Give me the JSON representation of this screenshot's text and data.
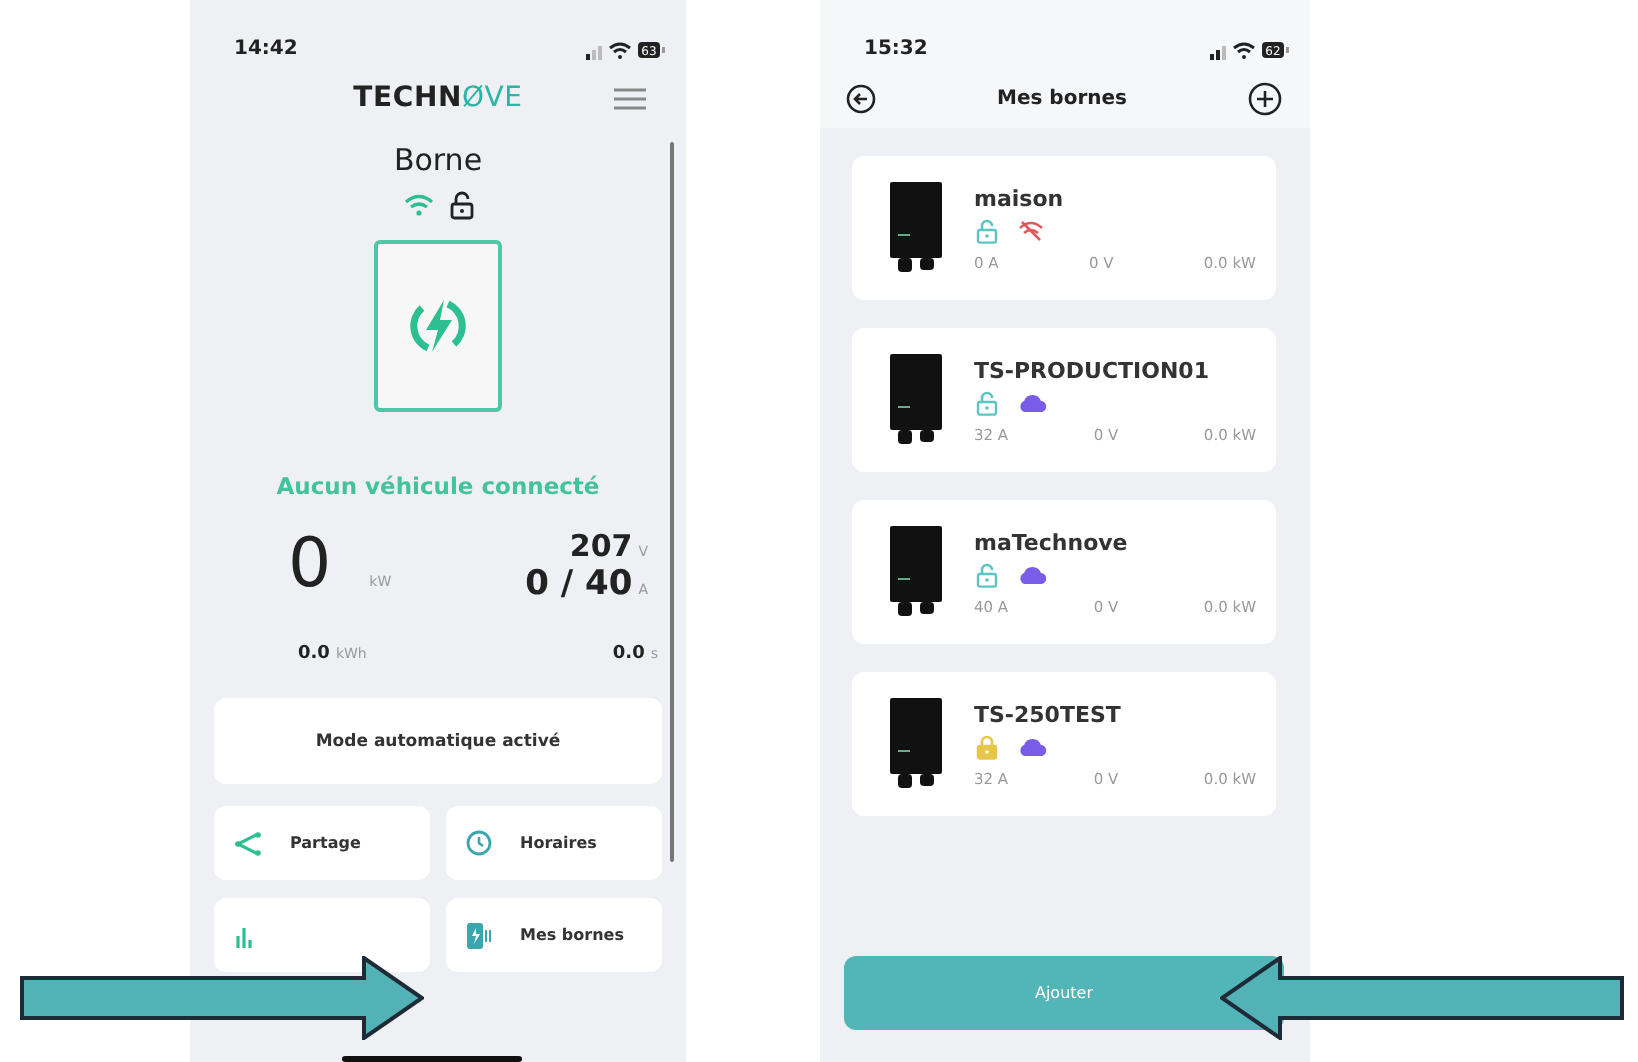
{
  "screens": [
    {
      "kind": "dashboard",
      "status": {
        "time": "14:42",
        "battery": "63"
      },
      "logo": {
        "dark": "TECHN",
        "accent": "ØVE"
      },
      "title": "Borne",
      "wifi": true,
      "locked": false,
      "message": "Aucun véhicule connecté",
      "power": {
        "value": "0",
        "unit": "kW"
      },
      "voltage": {
        "value": "207",
        "unit": "V"
      },
      "current": {
        "value": "0 / 40",
        "unit": "A"
      },
      "energy": {
        "value": "0.0",
        "unit": "kWh"
      },
      "duration": {
        "value": "0.0",
        "unit": "s"
      },
      "mode": "Mode automatique activé",
      "menu": [
        {
          "kind": "share",
          "label": "Partage"
        },
        {
          "kind": "clock",
          "label": "Horaires"
        },
        {
          "kind": "stats"
        },
        {
          "kind": "charger",
          "label": "Mes bornes"
        }
      ]
    },
    {
      "kind": "list",
      "status": {
        "time": "15:32",
        "battery": "62"
      },
      "title": "Mes bornes",
      "chargers": [
        {
          "name": "maison",
          "locked": false,
          "kind": "offline",
          "current": "0 A",
          "voltage": "0 V",
          "power": "0.0 kW"
        },
        {
          "name": "TS-PRODUCTION01",
          "locked": false,
          "kind": "cloud",
          "current": "32 A",
          "voltage": "0 V",
          "power": "0.0 kW"
        },
        {
          "name": "maTechnove",
          "locked": false,
          "kind": "cloud",
          "current": "40 A",
          "voltage": "0 V",
          "power": "0.0 kW"
        },
        {
          "name": "TS-250TEST",
          "locked": true,
          "kind": "cloud",
          "current": "32 A",
          "voltage": "0 V",
          "power": "0.0 kW"
        }
      ],
      "add_button": "Ajouter"
    }
  ],
  "arrows": [
    {
      "kind": "right"
    },
    {
      "kind": "left"
    }
  ]
}
